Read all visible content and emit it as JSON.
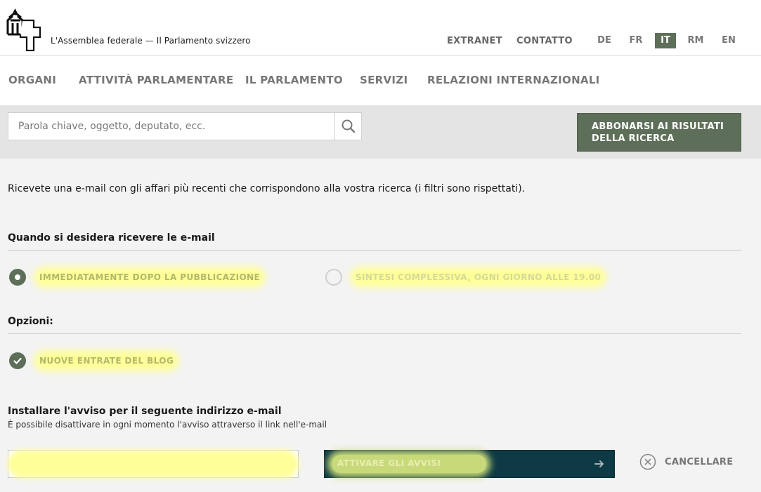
{
  "header": {
    "site_title": "L'Assemblea federale — Il Parlamento svizzero",
    "meta_links": [
      "EXTRANET",
      "CONTATTO"
    ],
    "languages": [
      "DE",
      "FR",
      "IT",
      "RM",
      "EN"
    ],
    "active_language": "IT"
  },
  "nav": {
    "items": [
      "ORGANI",
      "ATTIVITÀ PARLAMENTARE",
      "IL PARLAMENTO",
      "SERVIZI",
      "RELAZIONI INTERNAZIONALI"
    ]
  },
  "search": {
    "placeholder": "Parola chiave, oggetto, deputato, ecc.",
    "value": "",
    "subscribe_label": "ABBONARSI AI RISULTATI DELLA RICERCA"
  },
  "content": {
    "intro": "Ricevete una e-mail con gli affari più recenti che corrispondono alla vostra ricerca (i filtri sono rispettati).",
    "when_heading": "Quando si desidera ricevere le e-mail",
    "when_options": [
      {
        "label": "IMMEDIATAMENTE DOPO LA PUBBLICAZIONE",
        "selected": true
      },
      {
        "label": "SINTESI COMPLESSIVA, OGNI GIORNO ALLE 19.00",
        "selected": false
      }
    ],
    "options_heading": "Opzioni:",
    "options": [
      {
        "label": "NUOVE ENTRATE DEL BLOG",
        "checked": true
      }
    ],
    "email_heading": "Installare l'avviso per il seguente indirizzo e-mail",
    "email_subtext": "È possibile disattivare in ogni momento l'avviso attraverso il link nell'e-mail",
    "email_value": "",
    "activate_label": "ATTIVARE GLI AVVISI",
    "cancel_label": "CANCELLARE"
  },
  "colors": {
    "brand_green": "#5d6f58",
    "activate_bg": "#0d3a44",
    "highlight": "#ffff9a"
  },
  "icons": [
    "parliament-logo-icon",
    "search-icon",
    "radio-selected-icon",
    "checkmark-icon",
    "arrow-right-icon",
    "close-circle-icon"
  ]
}
